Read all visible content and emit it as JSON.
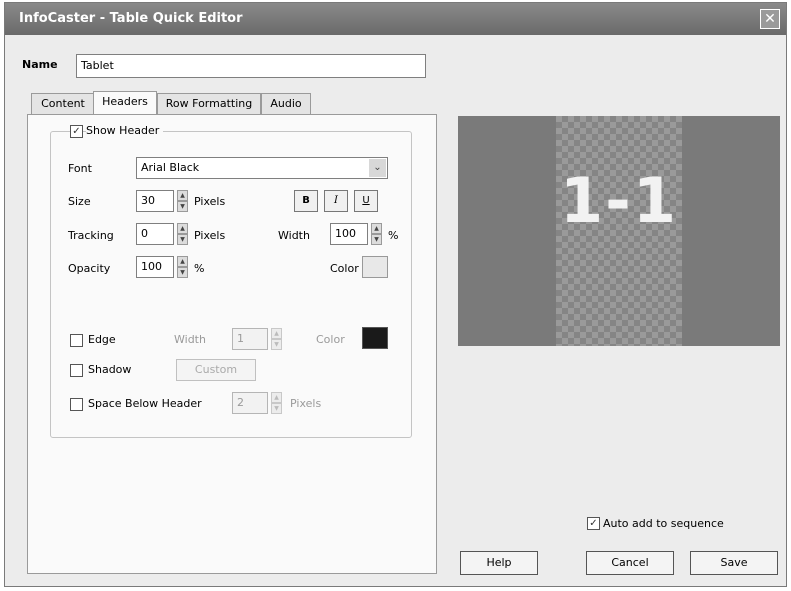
{
  "window": {
    "title": "InfoCaster - Table Quick Editor",
    "close_glyph": "✕"
  },
  "name_field": {
    "label": "Name",
    "value": "Tablet"
  },
  "tabs": [
    {
      "label": "Content"
    },
    {
      "label": "Headers"
    },
    {
      "label": "Row Formatting"
    },
    {
      "label": "Audio"
    }
  ],
  "headers": {
    "show_header": {
      "label": "Show Header",
      "checked": true
    },
    "font": {
      "label": "Font",
      "value": "Arial Black"
    },
    "size": {
      "label": "Size",
      "value": "30",
      "unit": "Pixels"
    },
    "style_buttons": {
      "bold": "B",
      "italic": "I",
      "underline": "U"
    },
    "tracking": {
      "label": "Tracking",
      "value": "0",
      "unit": "Pixels"
    },
    "width": {
      "label": "Width",
      "value": "100",
      "unit": "%"
    },
    "opacity": {
      "label": "Opacity",
      "value": "100",
      "unit": "%"
    },
    "color": {
      "label": "Color",
      "swatch": "#e8e8e8"
    },
    "edge": {
      "label": "Edge",
      "checked": false,
      "width_label": "Width",
      "width_value": "1",
      "color_label": "Color",
      "swatch": "#1a1a1a"
    },
    "shadow": {
      "label": "Shadow",
      "checked": false,
      "custom_button": "Custom"
    },
    "space_below": {
      "label": "Space Below Header",
      "checked": false,
      "value": "2",
      "unit": "Pixels"
    }
  },
  "preview": {
    "text": "1-1"
  },
  "auto_add": {
    "label": "Auto add to sequence",
    "checked": true
  },
  "buttons": {
    "help": "Help",
    "cancel": "Cancel",
    "save": "Save"
  },
  "icons": {
    "spin_up": "▲",
    "spin_down": "▼",
    "dropdown": "⌄",
    "check": "✓"
  }
}
